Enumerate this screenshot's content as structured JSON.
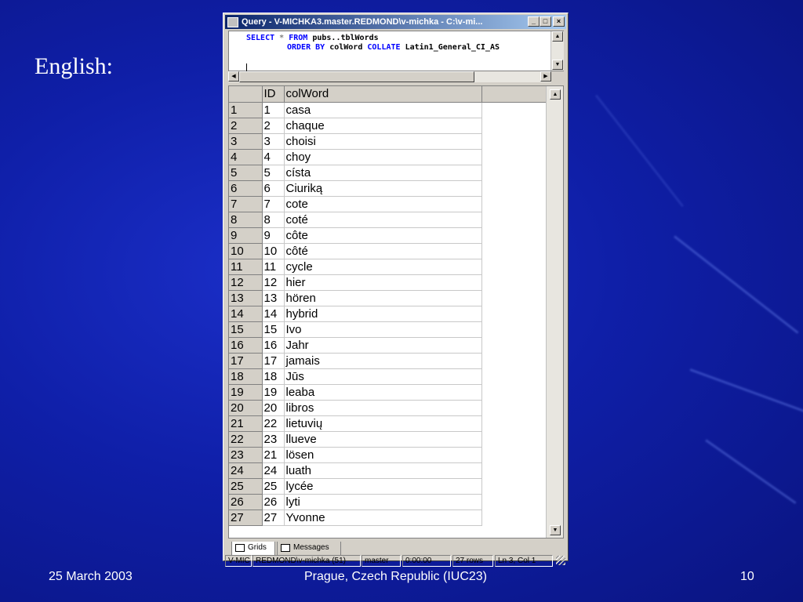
{
  "slide": {
    "title": "English:",
    "footer_date": "25 March 2003",
    "footer_center": "Prague, Czech Republic (IUC23)",
    "page_number": "10"
  },
  "window": {
    "title": "Query - V-MICHKA3.master.REDMOND\\v-michka - C:\\v-mi...",
    "buttons": {
      "minimize": "_",
      "maximize": "□",
      "close": "×"
    }
  },
  "query": {
    "line1": {
      "select": "SELECT",
      "star": "*",
      "from": "FROM",
      "table": "pubs..tblWords"
    },
    "line2": {
      "order_by": "ORDER BY",
      "column": "colWord",
      "collate": "COLLATE",
      "collation": "Latin1_General_CI_AS"
    }
  },
  "grid": {
    "columns": [
      "ID",
      "colWord"
    ],
    "rows": [
      {
        "n": "1",
        "id": "1",
        "word": "casa"
      },
      {
        "n": "2",
        "id": "2",
        "word": "chaque"
      },
      {
        "n": "3",
        "id": "3",
        "word": "choisi"
      },
      {
        "n": "4",
        "id": "4",
        "word": "choy"
      },
      {
        "n": "5",
        "id": "5",
        "word": "císta"
      },
      {
        "n": "6",
        "id": "6",
        "word": "Ciuriką"
      },
      {
        "n": "7",
        "id": "7",
        "word": "cote"
      },
      {
        "n": "8",
        "id": "8",
        "word": "coté"
      },
      {
        "n": "9",
        "id": "9",
        "word": "côte"
      },
      {
        "n": "10",
        "id": "10",
        "word": "côté"
      },
      {
        "n": "11",
        "id": "11",
        "word": "cycle"
      },
      {
        "n": "12",
        "id": "12",
        "word": "hier"
      },
      {
        "n": "13",
        "id": "13",
        "word": "hören"
      },
      {
        "n": "14",
        "id": "14",
        "word": "hybrid"
      },
      {
        "n": "15",
        "id": "15",
        "word": "Ivo"
      },
      {
        "n": "16",
        "id": "16",
        "word": "Jahr"
      },
      {
        "n": "17",
        "id": "17",
        "word": "jamais"
      },
      {
        "n": "18",
        "id": "18",
        "word": "Jūs"
      },
      {
        "n": "19",
        "id": "19",
        "word": "leaba"
      },
      {
        "n": "20",
        "id": "20",
        "word": "libros"
      },
      {
        "n": "21",
        "id": "22",
        "word": "lietuvių"
      },
      {
        "n": "22",
        "id": "23",
        "word": "llueve"
      },
      {
        "n": "23",
        "id": "21",
        "word": "lösen"
      },
      {
        "n": "24",
        "id": "24",
        "word": "luath"
      },
      {
        "n": "25",
        "id": "25",
        "word": "lycée"
      },
      {
        "n": "26",
        "id": "26",
        "word": "lyti"
      },
      {
        "n": "27",
        "id": "27",
        "word": "Yvonne"
      }
    ]
  },
  "tabs": [
    {
      "label": "Grids"
    },
    {
      "label": "Messages"
    }
  ],
  "status": {
    "server": "V-MIC",
    "user": "REDMOND\\v-michka (51)",
    "database": "master",
    "elapsed": "0:00:00",
    "rows": "27 rows",
    "position": "Ln 3, Col 1"
  },
  "colors": {
    "background": "#0f1fa8",
    "titlebar_start": "#0a246a",
    "keyword": "#0000ff",
    "operator": "#808080"
  }
}
